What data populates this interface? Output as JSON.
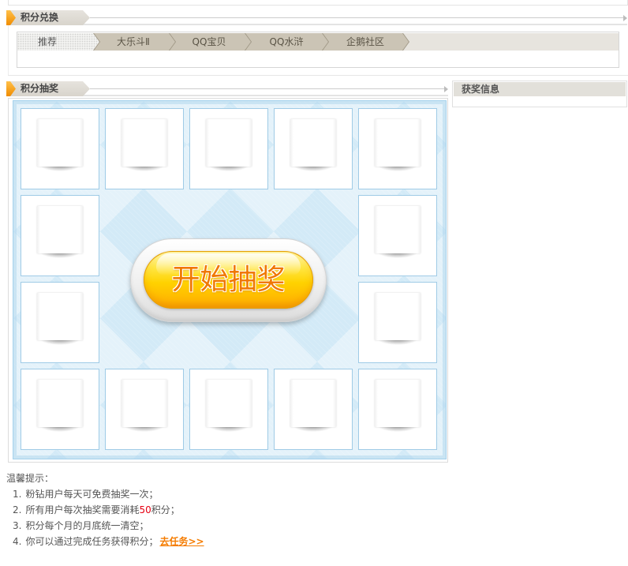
{
  "exchange": {
    "title": "积分兑换",
    "tabs": [
      {
        "label": "推荐",
        "active": true
      },
      {
        "label": "大乐斗Ⅱ",
        "active": false
      },
      {
        "label": "QQ宝贝",
        "active": false
      },
      {
        "label": "QQ水浒",
        "active": false
      },
      {
        "label": "企鹅社区",
        "active": false
      }
    ]
  },
  "lottery": {
    "title": "积分抽奖",
    "start_button_label": "开始抽奖"
  },
  "winners": {
    "title": "获奖信息"
  },
  "tips": {
    "title": "温馨提示：",
    "items": [
      {
        "number": "1.",
        "text": "粉钻用户每天可免费抽奖一次；"
      },
      {
        "number": "2.",
        "text": "所有用户每次抽奖需要消耗",
        "highlight": "50",
        "suffix": "积分；"
      },
      {
        "number": "3.",
        "text": "积分每个月的月底统一清空；"
      },
      {
        "number": "4.",
        "text": "你可以通过完成任务获得积分；",
        "link": "去任务>>"
      }
    ]
  },
  "colors": {
    "accent": "#f08c00",
    "highlight": "#e60012",
    "link": "#f57c00",
    "board": "#d3eaf7"
  }
}
